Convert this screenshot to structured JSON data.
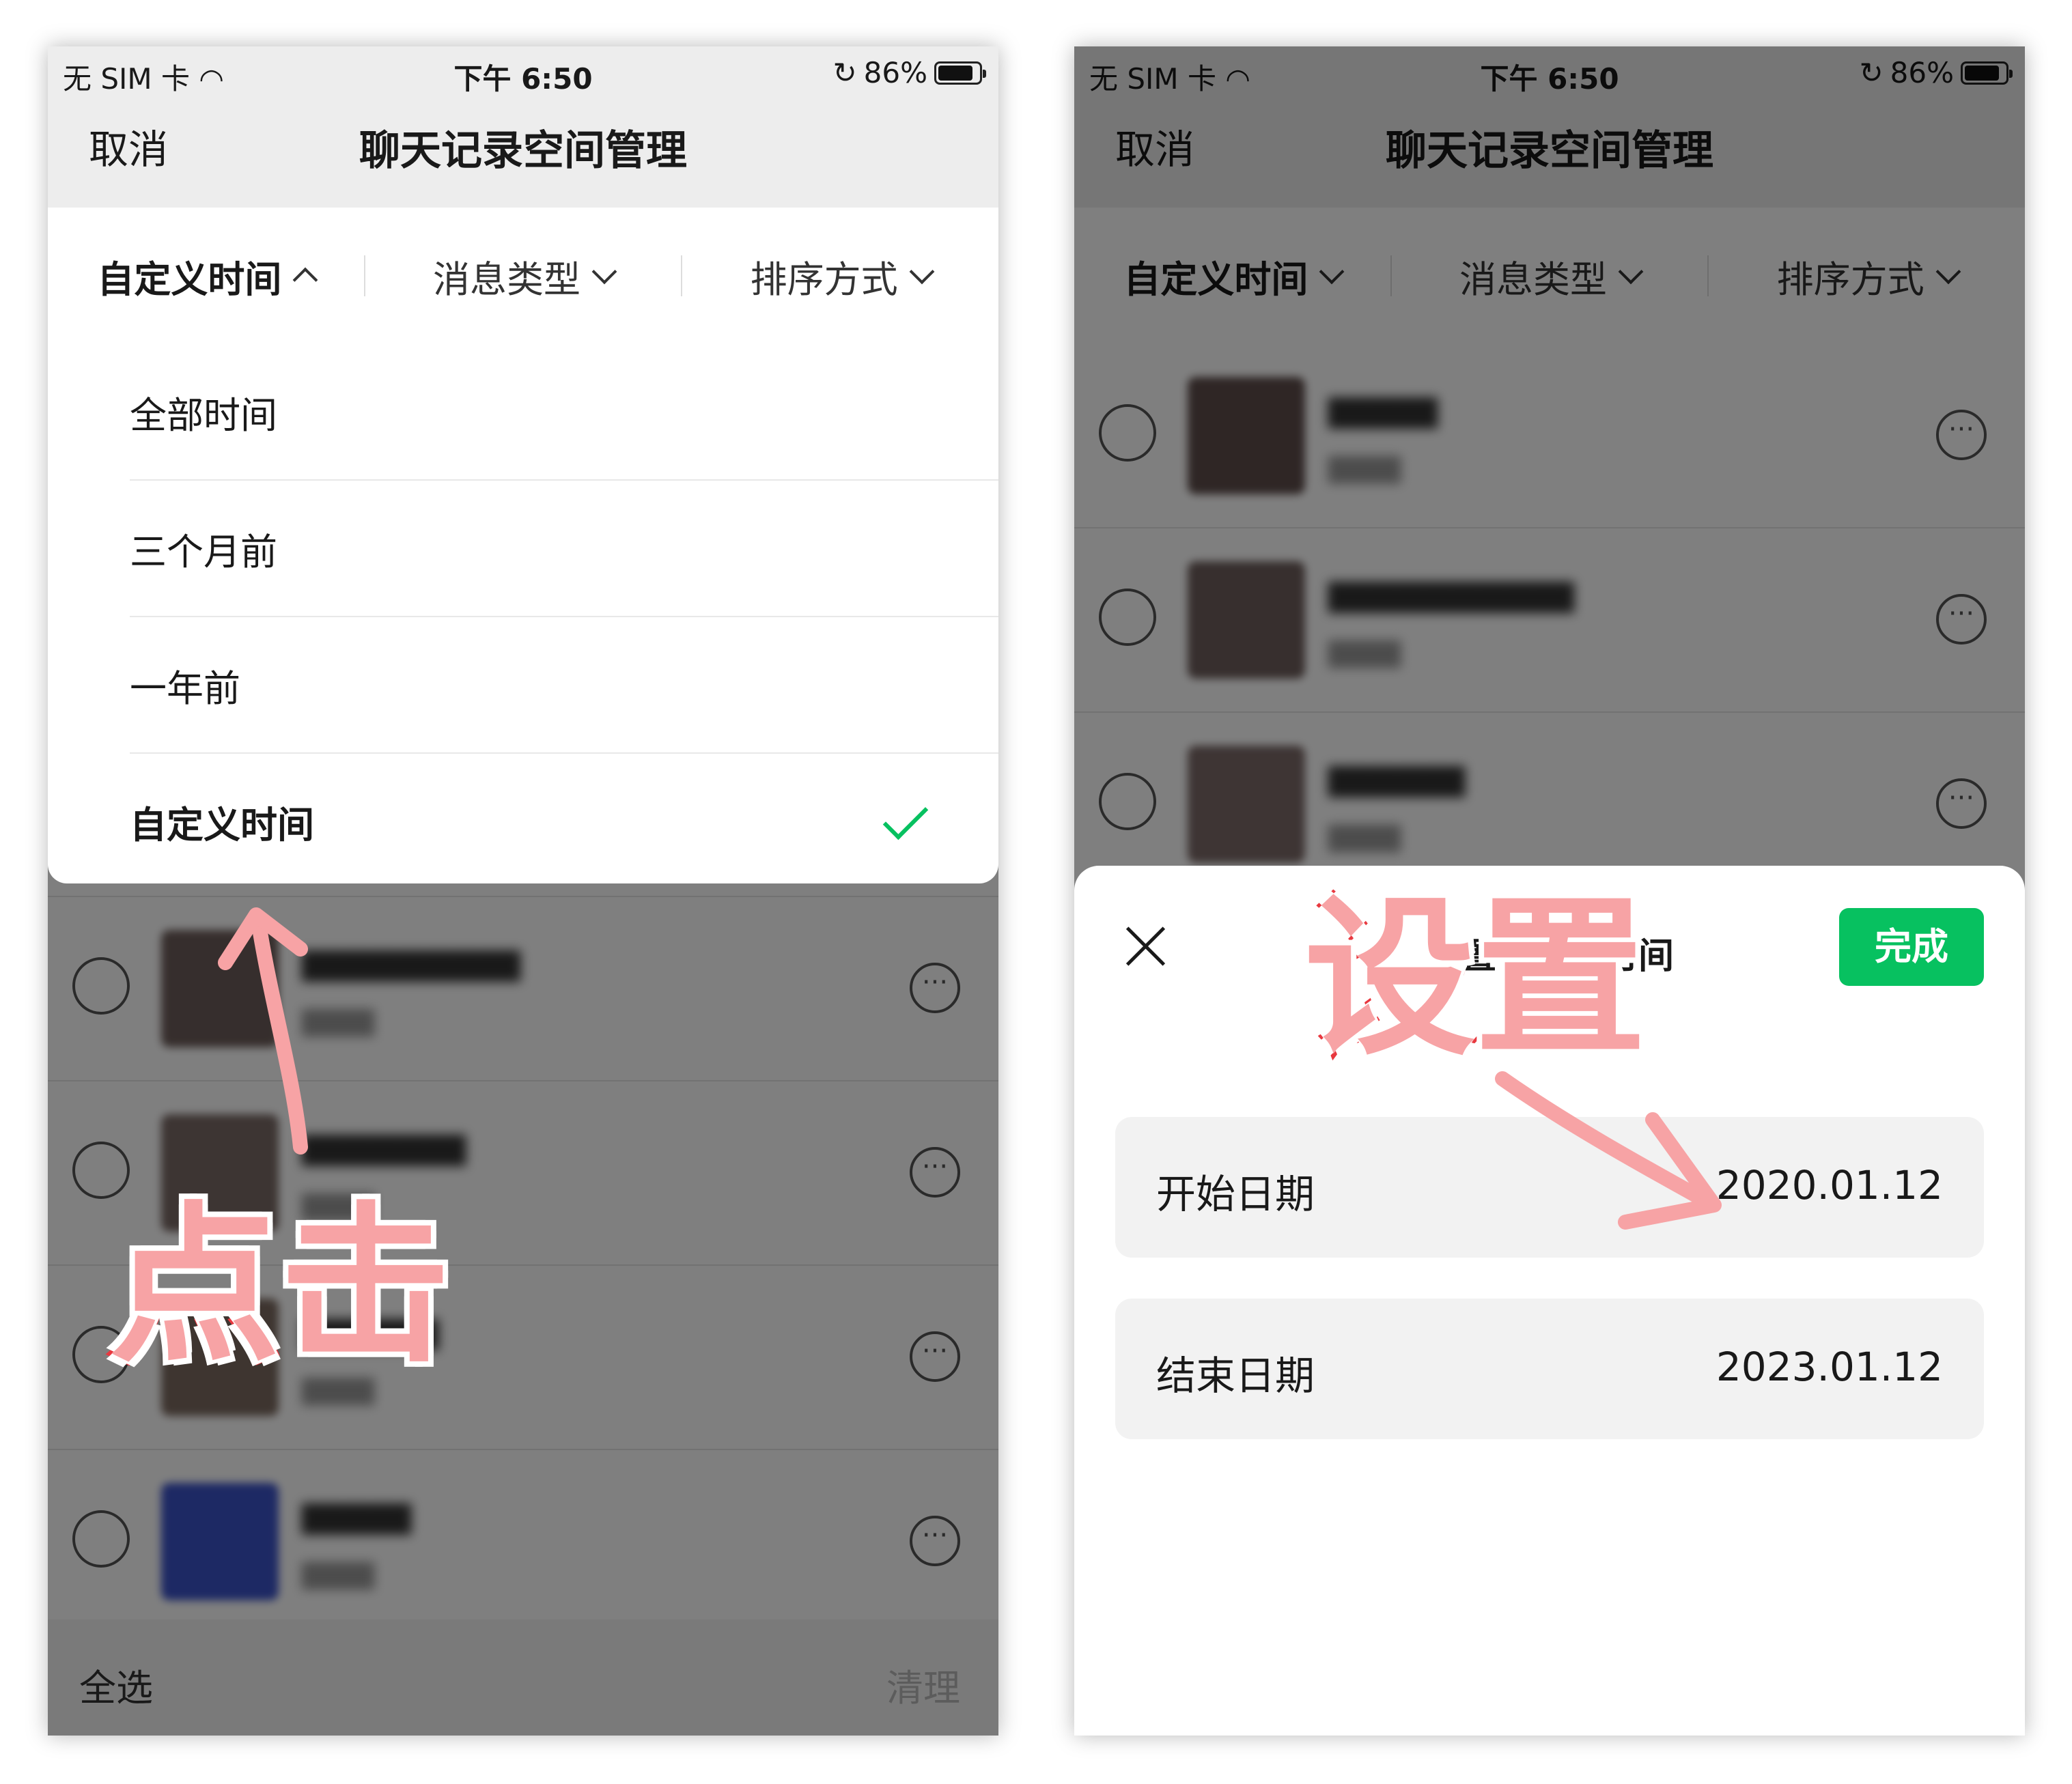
{
  "status": {
    "carrier": "无 SIM 卡",
    "time": "下午 6:50",
    "battery": "86%",
    "battery_level": 0.86
  },
  "nav": {
    "cancel": "取消",
    "title": "聊天记录空间管理"
  },
  "filters": [
    {
      "label": "自定义时间"
    },
    {
      "label": "消息类型"
    },
    {
      "label": "排序方式"
    }
  ],
  "dropdown": {
    "items": [
      {
        "label": "全部时间"
      },
      {
        "label": "三个月前"
      },
      {
        "label": "一年前"
      },
      {
        "label": "自定义时间"
      }
    ],
    "selected_index": 3
  },
  "bottom": {
    "select_all": "全选",
    "clean": "清理"
  },
  "sheet": {
    "title": "设置自定义时间",
    "done": "完成",
    "start_label": "开始日期",
    "start_value": "2020.01.12",
    "end_label": "结束日期",
    "end_value": "2023.01.12"
  },
  "annotations": {
    "click": "点击",
    "set": "设置",
    "color": "#f7a3a5",
    "stroke": "#e8383f"
  },
  "colors": {
    "accent": "#07c160"
  }
}
